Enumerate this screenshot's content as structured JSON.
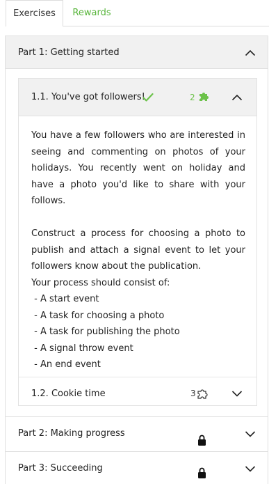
{
  "tabs": [
    {
      "label": "Exercises",
      "active": true
    },
    {
      "label": "Rewards",
      "active": false
    }
  ],
  "parts": [
    {
      "title": "Part 1: Getting started",
      "expanded": true,
      "locked": false
    },
    {
      "title": "Part 2: Making progress",
      "expanded": false,
      "locked": true
    },
    {
      "title": "Part 3: Succeeding",
      "expanded": false,
      "locked": true
    }
  ],
  "exercises": [
    {
      "title": "1.1. You've got followers!",
      "completed": true,
      "points": "2",
      "expanded": true,
      "description": {
        "para1": "You have a few followers who are interested in seeing and commenting on photos of your holidays. You recently went on holiday and have a photo you'd like to share with your follows.",
        "para2": "Construct a process for choosing a photo to publish and attach a signal event to let your followers know about the publication.",
        "intro": "Your process should consist of:",
        "items": [
          " - A start event",
          " - A task for choosing a photo",
          " - A task for publishing the photo",
          " - A signal throw event",
          " - An end event"
        ]
      }
    },
    {
      "title": "1.2. Cookie time",
      "completed": false,
      "points": "3",
      "expanded": false
    }
  ],
  "colors": {
    "accent_green": "#57b53a",
    "header_bg": "#f1f1f1",
    "border": "#e0e0e0"
  },
  "icons": {
    "completed": "check-icon",
    "points_earned": "puzzle-piece-filled-icon",
    "points_available": "puzzle-piece-outline-icon",
    "locked": "lock-icon",
    "collapse": "chevron-up-icon",
    "expand": "chevron-down-icon"
  }
}
